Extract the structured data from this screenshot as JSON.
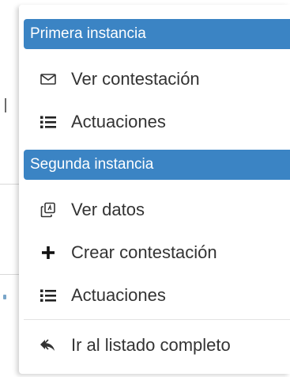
{
  "menu": {
    "sections": [
      {
        "header": "Primera instancia",
        "items": [
          {
            "label": "Ver contestación",
            "icon": "envelope-icon"
          },
          {
            "label": "Actuaciones",
            "icon": "list-icon"
          }
        ]
      },
      {
        "header": "Segunda instancia",
        "items": [
          {
            "label": "Ver datos",
            "icon": "copy-icon"
          },
          {
            "label": "Crear contestación",
            "icon": "plus-icon"
          },
          {
            "label": "Actuaciones",
            "icon": "list-icon"
          }
        ]
      }
    ],
    "footer_item": {
      "label": "Ir al listado completo",
      "icon": "reply-all-icon"
    }
  },
  "colors": {
    "header_bg": "#3b84c4",
    "header_text": "#ffffff",
    "item_text": "#333333",
    "divider": "#e3e3e3"
  }
}
